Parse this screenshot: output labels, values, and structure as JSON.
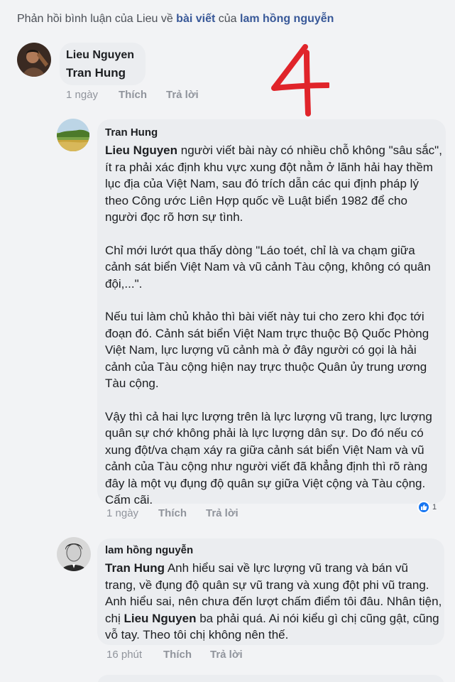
{
  "header": {
    "prefix": "Phản hồi bình luận của Lieu về ",
    "post_link": "bài viết",
    "middle": " của ",
    "author": "lam hồng nguyễn"
  },
  "comment1": {
    "name": "Lieu Nguyen",
    "text": "Tran Hung",
    "time": "1 ngày",
    "like": "Thích",
    "reply": "Trả lời"
  },
  "annotation": {
    "number": "4",
    "color": "#e0242a"
  },
  "reply1": {
    "name": "Tran Hung",
    "mention": "Lieu Nguyen",
    "p1": " người viết bài này có nhiều chỗ không \"sâu sắc\", ít ra phải xác định khu vực xung đột nằm ở lãnh hải hay thềm lục địa của Việt Nam, sau đó trích dẫn các qui định pháp lý theo Công ước Liên Hợp quốc về Luật biển 1982 để cho người đọc rõ hơn sự tình.",
    "p2": "Chỉ mới lướt qua thấy dòng \"Láo toét, chỉ là va chạm giữa cảnh sát biển Việt Nam và vũ cảnh Tàu cộng, không có quân đội,...\".",
    "p3": "Nếu tui làm chủ khảo thì bài viết này tui cho zero khi đọc tới đoạn đó. Cảnh sát biển Việt Nam trực thuộc Bộ Quốc Phòng Việt Nam, lực lượng vũ cảnh mà ở đây người có gọi là hải cảnh của Tàu cộng hiện nay trực thuộc Quân ủy trung ương Tàu cộng.",
    "p4": "Vậy thì cả hai lực lượng trên là lực lượng vũ trang, lực lượng quân sự chớ không phải là lực lượng dân sự. Do đó nếu có xung đột/va chạm xáy ra giữa cảnh sát biển Việt Nam và vũ cảnh của Tàu cộng như người viết đã khẳng định thì rõ ràng đây là một vụ đụng độ quân sự giữa Việt cộng và Tàu cộng. Cấm cãi.",
    "time": "1 ngày",
    "like": "Thích",
    "reply": "Trả lời",
    "reaction_count": "1"
  },
  "reply2": {
    "name": "lam hồng nguyễn",
    "mention": "Tran Hung",
    "text_a": " Anh hiểu  sai  về  lực  lượng vũ trang  và bán vũ trang, về đụng  độ quân sự  vũ trang và xung  đột  phi vũ trang. Anh hiểu sai, nên chưa đến lượt chấm điểm tôi đâu. Nhân tiện, chị ",
    "mention2": "Lieu Nguyen",
    "text_b": " ba phải quá. Ai nói kiểu gì chị cũng gật, cũng vỗ tay. Theo  tôi chị không nên thế.",
    "time": "16 phút",
    "like": "Thích",
    "reply": "Trả lời"
  }
}
